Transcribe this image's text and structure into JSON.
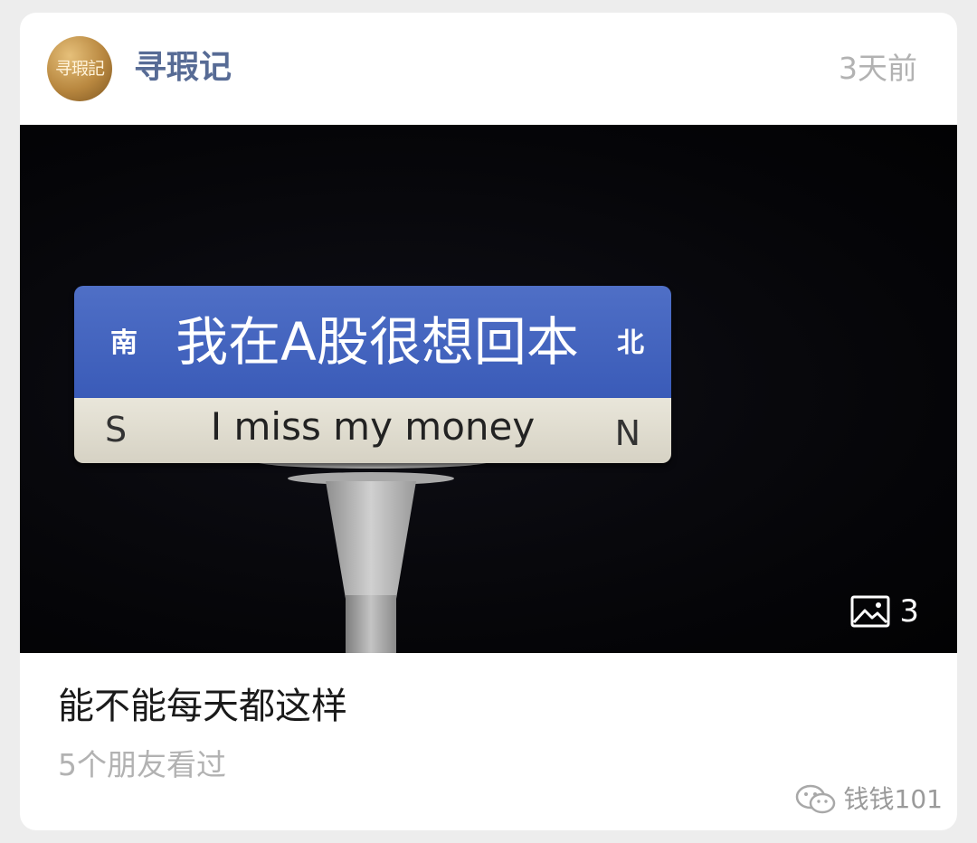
{
  "post": {
    "account_name": "寻瑕记",
    "avatar_text": "寻瑕記",
    "timestamp": "3天前",
    "image": {
      "sign": {
        "left_direction_cn": "南",
        "title_cn": "我在A股很想回本",
        "right_direction_cn": "北",
        "left_direction_en": "S",
        "subtitle_en": "I miss my money",
        "right_direction_en": "N",
        "top_color": "#3f60bd",
        "bottom_color": "#e2dfd3"
      },
      "photo_count": "3",
      "photo_count_icon": "image-gallery-icon"
    },
    "title": "能不能每天都这样",
    "view_count": "5个朋友看过"
  },
  "watermark": {
    "icon": "wechat-icon",
    "text": "钱钱101"
  },
  "colors": {
    "link_blue": "#576b95",
    "muted_gray": "#b2b2b2",
    "page_background": "#ededed"
  }
}
